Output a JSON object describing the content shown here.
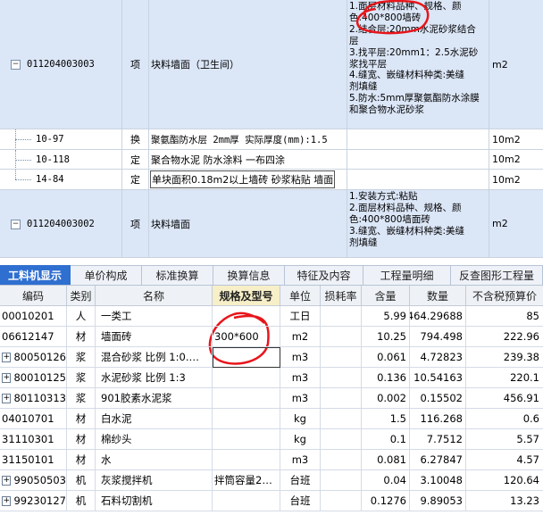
{
  "top_rows": [
    {
      "code": "011204003003",
      "type": "项",
      "name": "块料墙面（卫生间）",
      "desc": [
        "1.面层材料品种、规格、颜",
        "色:400*800墙砖",
        "2.结合层:20mm水泥砂浆结合",
        "层",
        "3.找平层:20mm1：2.5水泥砂",
        "浆找平层",
        "4.缝宽、嵌缝材料种类:美缝",
        "剂填缝",
        "5.防水:5mm厚聚氨酯防水涂膜",
        "和聚合物水泥砂浆"
      ],
      "unit": "m2"
    },
    {
      "code": "10-97",
      "type": "换",
      "name": "聚氨酯防水层 2mm厚  实际厚度(mm):1.5",
      "unit": "10m2"
    },
    {
      "code": "10-118",
      "type": "定",
      "name": "聚合物水泥 防水涂料 一布四涂",
      "unit": "10m2"
    },
    {
      "code": "14-84",
      "type": "定",
      "name": "单块面积0.18m2以上墙砖 砂浆粘贴 墙面",
      "unit": "10m2"
    },
    {
      "code": "011204003002",
      "type": "项",
      "name": "块料墙面",
      "desc": [
        "1.安装方式:粘贴",
        "2.面层材料品种、规格、颜",
        "色:400*800墙面砖",
        "3.缝宽、嵌缝材料种类:美缝",
        "剂填缝"
      ],
      "unit": "m2"
    }
  ],
  "tabs": [
    "工料机显示",
    "单价构成",
    "标准换算",
    "换算信息",
    "特征及内容",
    "工程量明细",
    "反查图形工程量"
  ],
  "headers": [
    "编码",
    "类别",
    "名称",
    "规格及型号",
    "单位",
    "损耗率",
    "含量",
    "数量",
    "不含税预算价"
  ],
  "materials": [
    {
      "code": "00010201",
      "type": "人",
      "name": "一类工",
      "spec": "",
      "unit": "工日",
      "loss": "",
      "content": "5.99",
      "qty": "464.29688",
      "price": "85",
      "expand": false
    },
    {
      "code": "06612147",
      "type": "材",
      "name": "墙面砖",
      "spec": "300*600",
      "unit": "m2",
      "loss": "",
      "content": "10.25",
      "qty": "794.498",
      "price": "222.96",
      "expand": false
    },
    {
      "code": "80050126",
      "type": "浆",
      "name": "混合砂浆 比例 1:0.…",
      "spec": "",
      "unit": "m3",
      "loss": "",
      "content": "0.061",
      "qty": "4.72823",
      "price": "239.38",
      "expand": true
    },
    {
      "code": "80010125",
      "type": "浆",
      "name": "水泥砂浆 比例 1:3",
      "spec": "",
      "unit": "m3",
      "loss": "",
      "content": "0.136",
      "qty": "10.54163",
      "price": "220.1",
      "expand": true
    },
    {
      "code": "80110313",
      "type": "浆",
      "name": "901胶素水泥浆",
      "spec": "",
      "unit": "m3",
      "loss": "",
      "content": "0.002",
      "qty": "0.15502",
      "price": "456.91",
      "expand": true
    },
    {
      "code": "04010701",
      "type": "材",
      "name": "白水泥",
      "spec": "",
      "unit": "kg",
      "loss": "",
      "content": "1.5",
      "qty": "116.268",
      "price": "0.6",
      "expand": false
    },
    {
      "code": "31110301",
      "type": "材",
      "name": "棉纱头",
      "spec": "",
      "unit": "kg",
      "loss": "",
      "content": "0.1",
      "qty": "7.7512",
      "price": "5.57",
      "expand": false
    },
    {
      "code": "31150101",
      "type": "材",
      "name": "水",
      "spec": "",
      "unit": "m3",
      "loss": "",
      "content": "0.081",
      "qty": "6.27847",
      "price": "4.57",
      "expand": false
    },
    {
      "code": "99050503",
      "type": "机",
      "name": "灰浆搅拌机",
      "spec": "拌筒容量2…",
      "unit": "台班",
      "loss": "",
      "content": "0.04",
      "qty": "3.10048",
      "price": "120.64",
      "expand": true
    },
    {
      "code": "99230127",
      "type": "机",
      "name": "石料切割机",
      "spec": "",
      "unit": "台班",
      "loss": "",
      "content": "0.1276",
      "qty": "9.89053",
      "price": "13.23",
      "expand": true
    }
  ],
  "colors": {
    "row_blue": "#dbe6f7",
    "tab_active": "#2f6fd0",
    "annotation": "#e8151b"
  },
  "icons": {
    "collapse": "minus-box-icon",
    "expand": "plus-box-icon"
  }
}
